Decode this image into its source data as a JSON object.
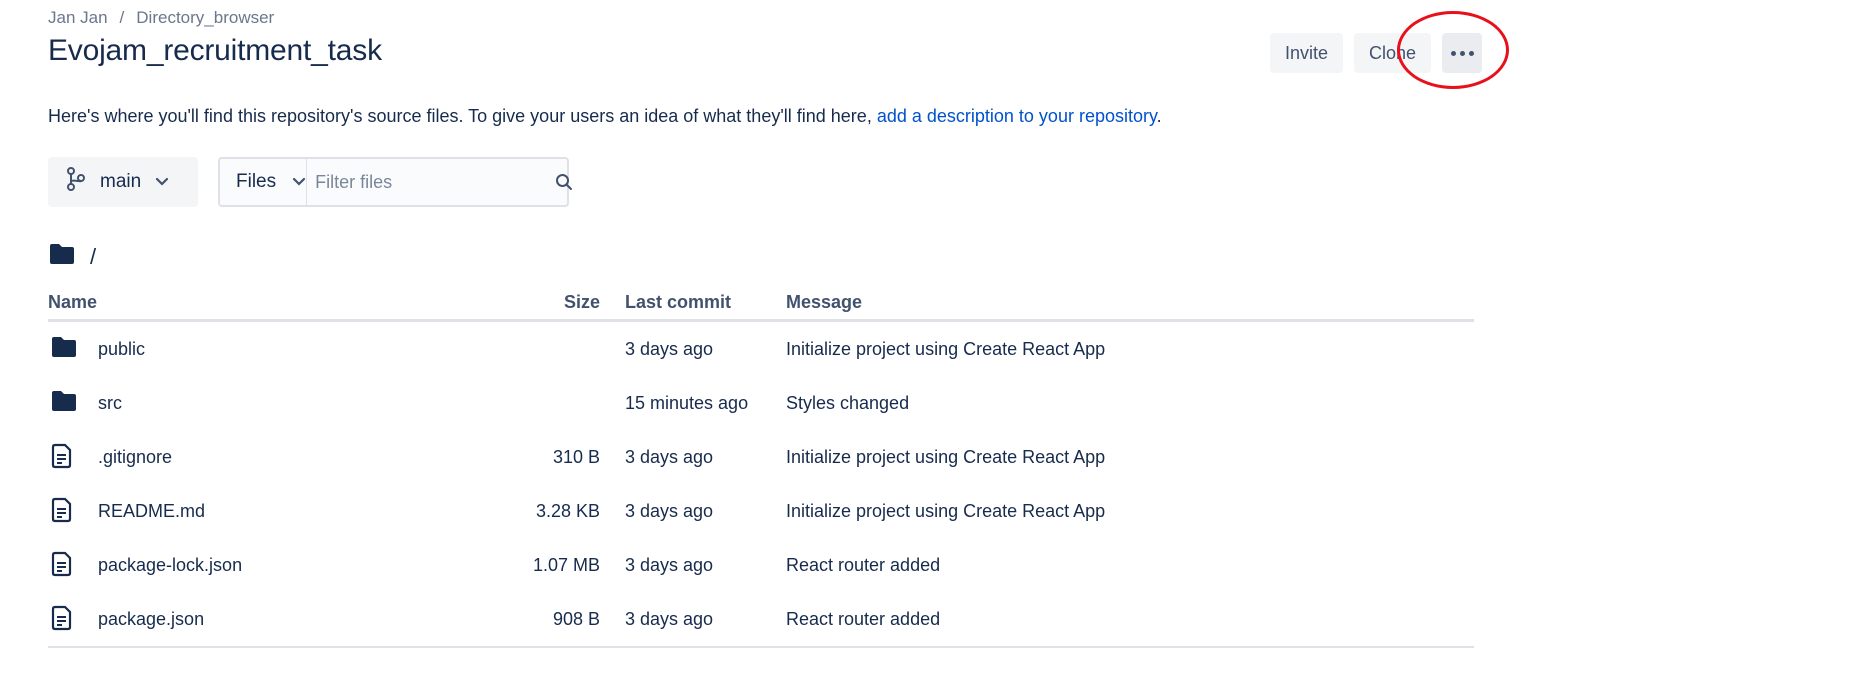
{
  "breadcrumb": {
    "workspace": "Jan Jan",
    "separator": "/",
    "project": "Directory_browser"
  },
  "repo": {
    "title": "Evojam_recruitment_task"
  },
  "actions": {
    "invite": "Invite",
    "clone": "Clone",
    "more_icon": "more-horizontal-icon"
  },
  "description": {
    "text": "Here's where you'll find this repository's source files. To give your users an idea of what they'll find here, ",
    "link": "add a description to your repository",
    "end": "."
  },
  "branch": {
    "name": "main",
    "icon": "branch-icon"
  },
  "filter": {
    "type_label": "Files",
    "placeholder": "Filter files"
  },
  "path": {
    "current": "/"
  },
  "table": {
    "headers": {
      "name": "Name",
      "size": "Size",
      "last_commit": "Last commit",
      "message": "Message"
    },
    "rows": [
      {
        "type": "folder",
        "name": "public",
        "size": "",
        "last_commit": "3 days ago",
        "message": "Initialize project using Create React App"
      },
      {
        "type": "folder",
        "name": "src",
        "size": "",
        "last_commit": "15 minutes ago",
        "message": "Styles changed"
      },
      {
        "type": "file",
        "name": ".gitignore",
        "size": "310 B",
        "last_commit": "3 days ago",
        "message": "Initialize project using Create React App"
      },
      {
        "type": "file",
        "name": "README.md",
        "size": "3.28 KB",
        "last_commit": "3 days ago",
        "message": "Initialize project using Create React App"
      },
      {
        "type": "file",
        "name": "package-lock.json",
        "size": "1.07 MB",
        "last_commit": "3 days ago",
        "message": "React router added"
      },
      {
        "type": "file",
        "name": "package.json",
        "size": "908 B",
        "last_commit": "3 days ago",
        "message": "React router added"
      }
    ]
  },
  "colors": {
    "text": "#172b4d",
    "link": "#0052cc",
    "annotation": "#e8101a",
    "button_bg": "#f4f5f7"
  }
}
